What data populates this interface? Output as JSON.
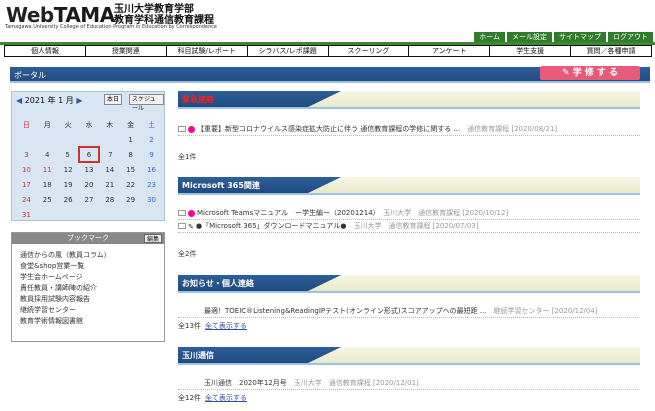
{
  "header": {
    "logo_web": "Web",
    "logo_tama": "TAMA",
    "uni_line1": "玉川大学教育学部",
    "uni_line2": "教育学科通信教育課程",
    "sub": "Tamagawa University College of Education Program in Education by Correspondence"
  },
  "topnav": [
    "ホーム",
    "メール設定",
    "サイトマップ",
    "ログアウト"
  ],
  "menu": [
    "個人情報",
    "授業関連",
    "科目試験/レポート",
    "シラバス/レポ課題",
    "スクーリング",
    "アンケート",
    "学生支援",
    "質問／各種申請"
  ],
  "portal": {
    "label": "ポータル",
    "gakushu": "学 修 す る"
  },
  "calendar": {
    "year_month": "2021 年 1 月",
    "today_btn": "本日",
    "schedule_btn": "スケジュール",
    "weekdays": [
      "日",
      "月",
      "火",
      "水",
      "木",
      "金",
      "土"
    ],
    "rows": [
      [
        "3",
        "4",
        "5",
        "6",
        "7",
        "8",
        "9"
      ],
      [
        "10",
        "11",
        "12",
        "13",
        "14",
        "15",
        "16"
      ],
      [
        "17",
        "18",
        "19",
        "20",
        "21",
        "22",
        "23"
      ],
      [
        "24",
        "25",
        "26",
        "27",
        "28",
        "29",
        "30"
      ],
      [
        "31",
        "",
        "",
        "",
        "",
        "",
        ""
      ]
    ],
    "first_row": [
      "",
      "",
      "",
      "",
      "",
      "1",
      "2"
    ]
  },
  "bookmark": {
    "title": "ブックマーク",
    "edit": "編集",
    "items": [
      "通信からの風（教員コラム）",
      "食堂&shop営業一覧",
      "学生会ホームページ",
      "責任教員・講師陣の紹介",
      "教員採用試験内容報告",
      "継続学習センター",
      "教育学術情報図書館"
    ]
  },
  "sections": [
    {
      "title": "緊急連絡",
      "rows": [
        "【重要】新型コロナウイルス感染症拡大防止に伴う 通信教育課程の学修に関する ..."
      ],
      "meta": [
        "通信教育課程 [2020/08/21]"
      ],
      "count": "全1件",
      "more": ""
    },
    {
      "title": "Microsoft 365関連",
      "rows": [
        "Microsoft Teamsマニュアル　ー学生編ー（20201214）",
        "●「Microsoft 365」ダウンロードマニュアル●"
      ],
      "meta": [
        "玉川大学　通信教育課程 [2020/10/12]",
        "玉川大学　通信教育課程 [2020/07/03]"
      ],
      "count": "全2件",
      "more": ""
    },
    {
      "title": "お知らせ・個人連絡",
      "rows": [
        "最適！TOEIC®Listening&ReadingIPテスト(オンライン形式)スコアアップへの最短距 ..."
      ],
      "meta": [
        "継続学習センター [2020/12/04]"
      ],
      "count": "全13件",
      "more": "全て表示する"
    },
    {
      "title": "玉川通信",
      "rows": [
        "玉川通信　2020年12月号"
      ],
      "meta": [
        "玉川大学　通信教育課程 [2020/12/01]"
      ],
      "count": "全12件",
      "more": "全て表示する"
    }
  ]
}
